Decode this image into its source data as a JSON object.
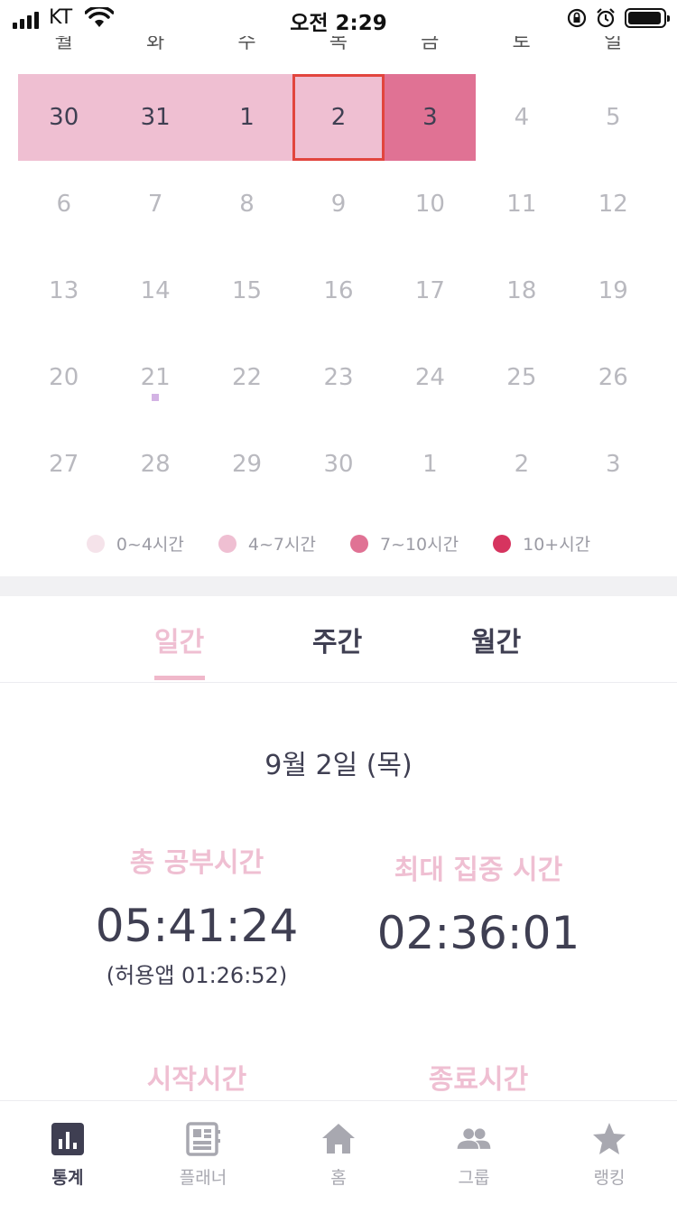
{
  "status_bar": {
    "carrier": "KT",
    "time": "오전 2:29"
  },
  "calendar": {
    "weekdays": [
      "월",
      "화",
      "수",
      "목",
      "금",
      "토",
      "일"
    ],
    "weeks": [
      [
        "30",
        "31",
        "1",
        "2",
        "3",
        "4",
        "5"
      ],
      [
        "6",
        "7",
        "8",
        "9",
        "10",
        "11",
        "12"
      ],
      [
        "13",
        "14",
        "15",
        "16",
        "17",
        "18",
        "19"
      ],
      [
        "20",
        "21",
        "22",
        "23",
        "24",
        "25",
        "26"
      ],
      [
        "27",
        "28",
        "29",
        "30",
        "1",
        "2",
        "3"
      ]
    ],
    "study_levels": [
      [
        2,
        2,
        2,
        2,
        3,
        0,
        0
      ],
      [
        0,
        0,
        0,
        0,
        0,
        0,
        0
      ],
      [
        0,
        0,
        0,
        0,
        0,
        0,
        0
      ],
      [
        0,
        0,
        0,
        0,
        0,
        0,
        0
      ],
      [
        0,
        0,
        0,
        0,
        0,
        0,
        0
      ]
    ],
    "selected_day": {
      "week": 0,
      "day": 3
    },
    "marked_day": {
      "week": 3,
      "day": 1
    }
  },
  "legend": [
    {
      "label": "0~4시간",
      "color": "#f5e3ea"
    },
    {
      "label": "4~7시간",
      "color": "#efbfd2"
    },
    {
      "label": "7~10시간",
      "color": "#e07294"
    },
    {
      "label": "10+시간",
      "color": "#d6345f"
    }
  ],
  "tabs": [
    {
      "label": "일간",
      "active": true
    },
    {
      "label": "주간",
      "active": false
    },
    {
      "label": "월간",
      "active": false
    }
  ],
  "summary": {
    "date": "9월 2일 (목)",
    "total_label": "총 공부시간",
    "total_value": "05:41:24",
    "total_sub": "(허용앱  01:26:52)",
    "focus_label": "최대 집중 시간",
    "focus_value": "02:36:01",
    "start_label": "시작시간",
    "end_label": "종료시간"
  },
  "nav": [
    {
      "label": "통계",
      "icon": "stats-icon",
      "active": true
    },
    {
      "label": "플래너",
      "icon": "planner-icon",
      "active": false
    },
    {
      "label": "홈",
      "icon": "home-icon",
      "active": false
    },
    {
      "label": "그룹",
      "icon": "group-icon",
      "active": false
    },
    {
      "label": "랭킹",
      "icon": "star-icon",
      "active": false
    }
  ],
  "colors": {
    "accent": "#efbfd2",
    "selected_border": "#e2453e",
    "text": "#3f3f52",
    "muted": "#b9b9bf"
  }
}
